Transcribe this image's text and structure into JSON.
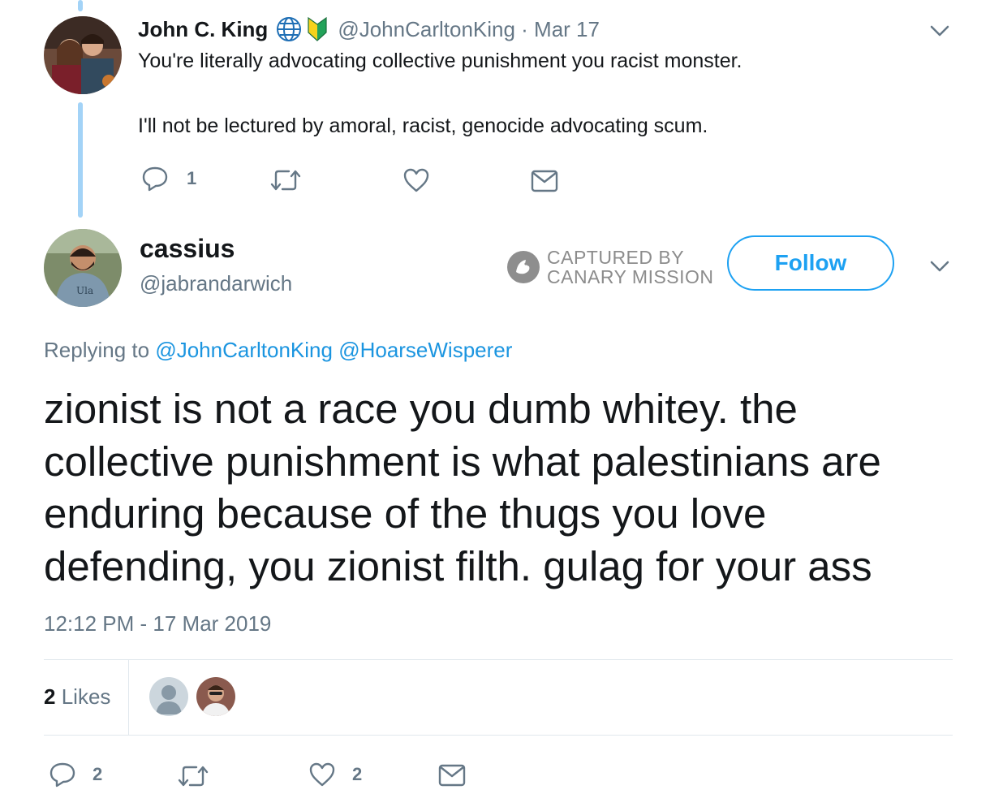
{
  "parent_tweet": {
    "author_name": "John C. King",
    "handle_date": "@JohnCarltonKing · Mar 17",
    "line1": "You're literally advocating collective punishment you racist monster.",
    "line2": "I'll not be lectured by amoral, racist, genocide advocating scum.",
    "reply_count": "1"
  },
  "main_tweet": {
    "author_name": "cassius",
    "handle": "@jabrandarwich",
    "watermark_line1": "CAPTURED BY",
    "watermark_line2": "CANARY MISSION",
    "follow_label": "Follow",
    "replying_prefix": "Replying to",
    "replying_user1": "@JohnCarltonKing",
    "replying_user2": "@HoarseWisperer",
    "text_line1": "zionist is not a race you dumb whitey. the",
    "text_line2": "collective punishment is what palestinians are",
    "text_line3": "enduring because of the thugs you love",
    "text_line4": "defending, you zionist filth. gulag for your ass",
    "timestamp": "12:12 PM - 17 Mar 2019",
    "likes_count": "2",
    "likes_label": "Likes",
    "reply_count": "2",
    "like_count": "2"
  },
  "colors": {
    "text": "#14171a",
    "muted": "#657786",
    "link": "#1b95e0",
    "accent": "#1da1f2",
    "thread_line": "#a3d3f7",
    "divider": "#e1e8ed"
  }
}
